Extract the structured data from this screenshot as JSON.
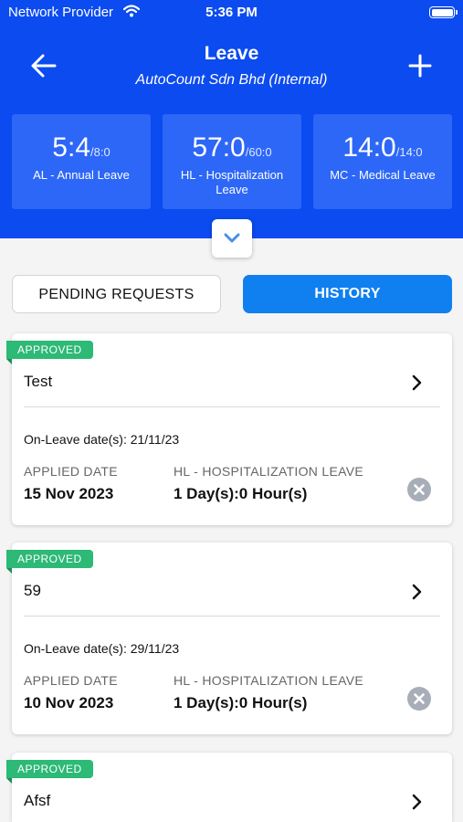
{
  "status_bar": {
    "carrier": "Network Provider",
    "time": "5:36 PM"
  },
  "header": {
    "title": "Leave",
    "subtitle": "AutoCount Sdn Bhd (Internal)"
  },
  "balances": [
    {
      "used": "5:4",
      "total": "/8:0",
      "label": "AL - Annual Leave"
    },
    {
      "used": "57:0",
      "total": "/60:0",
      "label": "HL - Hospitalization Leave"
    },
    {
      "used": "14:0",
      "total": "/14:0",
      "label": "MC - Medical Leave"
    }
  ],
  "tabs": {
    "pending": "PENDING REQUESTS",
    "history": "HISTORY",
    "active": "history"
  },
  "colors": {
    "header_bg": "#0b4bf0",
    "card_bg": "#2d67f7",
    "tab_active": "#1080f0",
    "approved": "#2db976"
  },
  "requests": [
    {
      "status": "APPROVED",
      "title": "Test",
      "on_leave": "On-Leave date(s): 21/11/23",
      "applied_label": "APPLIED DATE",
      "applied_date": "15 Nov 2023",
      "leave_type": "HL - HOSPITALIZATION LEAVE",
      "duration": "1 Day(s):0 Hour(s)"
    },
    {
      "status": "APPROVED",
      "title": "59",
      "on_leave": "On-Leave date(s): 29/11/23",
      "applied_label": "APPLIED DATE",
      "applied_date": "10 Nov 2023",
      "leave_type": "HL - HOSPITALIZATION LEAVE",
      "duration": "1 Day(s):0 Hour(s)"
    },
    {
      "status": "APPROVED",
      "title": "Afsf"
    }
  ]
}
